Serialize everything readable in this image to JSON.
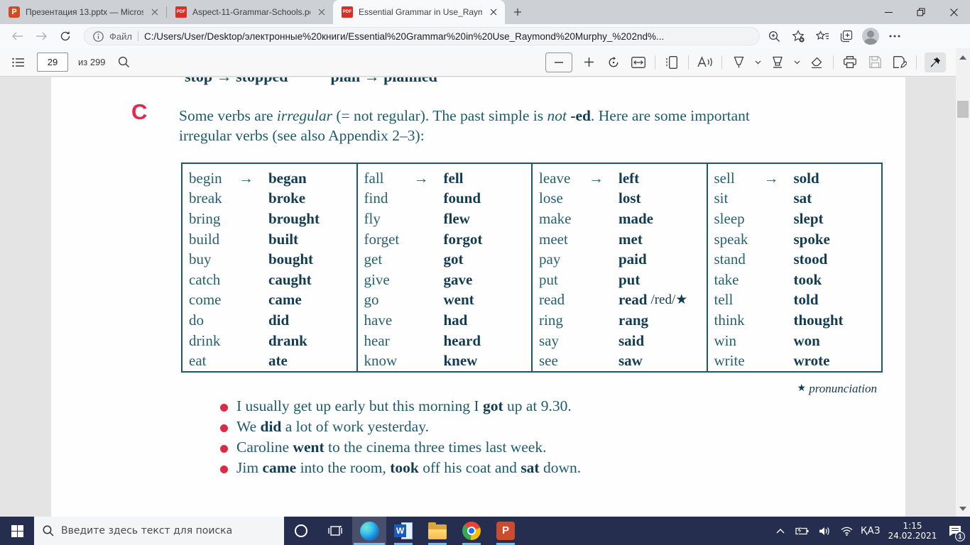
{
  "colors": {
    "ink_regular": "#26616f",
    "ink_bold": "#123c52",
    "accent_red": "#e8254c",
    "bullet_red": "#d92b45",
    "table_border": "#1e5765",
    "taskbar_bg": "#262e4f",
    "underline_blue": "#76b9e3"
  },
  "icons": {
    "pdf_badge": "PDF",
    "powerpoint_badge": "P",
    "word_badge": "W"
  },
  "browser": {
    "tabs": [
      {
        "title": "Презентация 13.pptx — Microso"
      },
      {
        "title": "Aspect-11-Grammar-Schools.pdf"
      },
      {
        "title": "Essential Grammar in Use_Raymo"
      }
    ],
    "address": {
      "scheme_label": "Файл",
      "url": "C:/Users/User/Desktop/электронные%20книги/Essential%20Grammar%20in%20Use_Raymond%20Murphy_%202nd%..."
    }
  },
  "pdf_toolbar": {
    "page": "29",
    "of_label": "из 299"
  },
  "page": {
    "clipped_line_left": "stop → stopped",
    "clipped_line_right": "plan → planned",
    "section_letter": "C",
    "intro_line1": [
      {
        "t": "Some verbs are "
      },
      {
        "t": "irregular",
        "i": true
      },
      {
        "t": " (= not regular). The past simple is "
      },
      {
        "t": "not",
        "i": true
      },
      {
        "t": " "
      },
      {
        "t": "-ed",
        "b": true
      },
      {
        "t": ". Here are some important"
      }
    ],
    "intro_line2": [
      {
        "t": "irregular verbs (see also Appendix 2–3):"
      }
    ],
    "verb_table": {
      "arrow": "→",
      "columns": [
        [
          {
            "base": "begin",
            "past": "began"
          },
          {
            "base": "break",
            "past": "broke"
          },
          {
            "base": "bring",
            "past": "brought"
          },
          {
            "base": "build",
            "past": "built"
          },
          {
            "base": "buy",
            "past": "bought"
          },
          {
            "base": "catch",
            "past": "caught"
          },
          {
            "base": "come",
            "past": "came"
          },
          {
            "base": "do",
            "past": "did"
          },
          {
            "base": "drink",
            "past": "drank"
          },
          {
            "base": "eat",
            "past": "ate"
          }
        ],
        [
          {
            "base": "fall",
            "past": "fell"
          },
          {
            "base": "find",
            "past": "found"
          },
          {
            "base": "fly",
            "past": "flew"
          },
          {
            "base": "forget",
            "past": "forgot"
          },
          {
            "base": "get",
            "past": "got"
          },
          {
            "base": "give",
            "past": "gave"
          },
          {
            "base": "go",
            "past": "went"
          },
          {
            "base": "have",
            "past": "had"
          },
          {
            "base": "hear",
            "past": "heard"
          },
          {
            "base": "know",
            "past": "knew"
          }
        ],
        [
          {
            "base": "leave",
            "past": "left"
          },
          {
            "base": "lose",
            "past": "lost"
          },
          {
            "base": "make",
            "past": "made"
          },
          {
            "base": "meet",
            "past": "met"
          },
          {
            "base": "pay",
            "past": "paid"
          },
          {
            "base": "put",
            "past": "put"
          },
          {
            "base": "read",
            "past": "read",
            "note": "/red/★"
          },
          {
            "base": "ring",
            "past": "rang"
          },
          {
            "base": "say",
            "past": "said"
          },
          {
            "base": "see",
            "past": "saw"
          }
        ],
        [
          {
            "base": "sell",
            "past": "sold"
          },
          {
            "base": "sit",
            "past": "sat"
          },
          {
            "base": "sleep",
            "past": "slept"
          },
          {
            "base": "speak",
            "past": "spoke"
          },
          {
            "base": "stand",
            "past": "stood"
          },
          {
            "base": "take",
            "past": "took"
          },
          {
            "base": "tell",
            "past": "told"
          },
          {
            "base": "think",
            "past": "thought"
          },
          {
            "base": "win",
            "past": "won"
          },
          {
            "base": "write",
            "past": "wrote"
          }
        ]
      ]
    },
    "footnote_star": "★",
    "footnote_text": "pronunciation",
    "examples": [
      {
        "segs": [
          {
            "t": "I usually get up early but this morning I "
          },
          {
            "t": "got",
            "b": true
          },
          {
            "t": " up at 9.30."
          }
        ]
      },
      {
        "segs": [
          {
            "t": "We "
          },
          {
            "t": "did",
            "b": true
          },
          {
            "t": " a lot of work yesterday."
          }
        ]
      },
      {
        "segs": [
          {
            "t": "Caroline "
          },
          {
            "t": "went",
            "b": true
          },
          {
            "t": " to the cinema three times last week."
          }
        ]
      },
      {
        "segs": [
          {
            "t": "Jim "
          },
          {
            "t": "came",
            "b": true
          },
          {
            "t": " into the room, "
          },
          {
            "t": "took",
            "b": true
          },
          {
            "t": " off his coat and "
          },
          {
            "t": "sat",
            "b": true
          },
          {
            "t": " down."
          }
        ]
      }
    ]
  },
  "taskbar": {
    "search_placeholder": "Введите здесь текст для поиска",
    "tray": {
      "lang": "ҚАЗ",
      "time": "1:15",
      "date": "24.02.2021",
      "badge": "1"
    }
  }
}
